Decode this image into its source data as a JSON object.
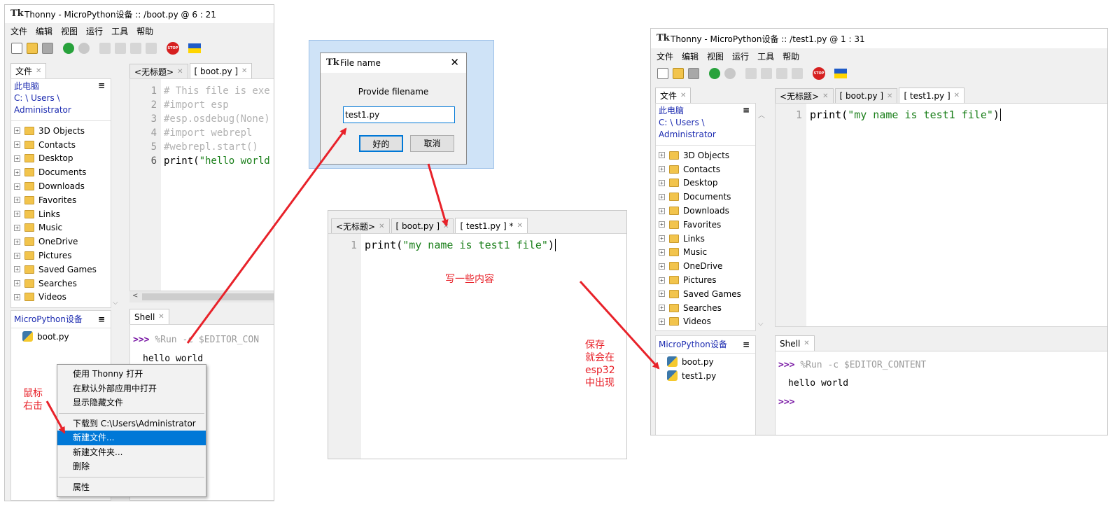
{
  "left_window": {
    "title": "Thonny  -  MicroPython设备 :: /boot.py  @  6 : 21",
    "menu": [
      "文件",
      "编辑",
      "视图",
      "运行",
      "工具",
      "帮助"
    ],
    "files_tab": "文件",
    "editor_tabs": [
      "<无标题>",
      "[ boot.py ]"
    ],
    "file_header": [
      "此电脑",
      "C: \\ Users \\",
      "Administrator"
    ],
    "folders": [
      "3D Objects",
      "Contacts",
      "Desktop",
      "Documents",
      "Downloads",
      "Favorites",
      "Links",
      "Music",
      "OneDrive",
      "Pictures",
      "Saved Games",
      "Searches",
      "Videos"
    ],
    "device_header": "MicroPython设备",
    "device_files": [
      "boot.py"
    ],
    "line_numbers": [
      "1",
      "2",
      "3",
      "4",
      "5",
      "6"
    ],
    "code": [
      "# This file is exe",
      "#import esp",
      "#esp.osdebug(None)",
      "#import webrepl",
      "#webrepl.start()",
      "print(\"hello world"
    ],
    "shell_tab": "Shell",
    "shell_prompt": ">>>",
    "shell_cmd": "%Run -c $EDITOR_CON",
    "shell_output": "hello world"
  },
  "context_menu": {
    "group1": [
      "使用 Thonny 打开",
      "在默认外部应用中打开",
      "显示隐藏文件"
    ],
    "group2": [
      "下载到 C:\\Users\\Administrator",
      "新建文件...",
      "新建文件夹...",
      "删除"
    ],
    "group3": [
      "属性"
    ],
    "highlighted": "新建文件..."
  },
  "dialog": {
    "title": "File name",
    "close": "✕",
    "prompt": "Provide filename",
    "value": "test1.py",
    "ok": "好的",
    "cancel": "取消"
  },
  "mid_editor": {
    "tabs": [
      "<无标题>",
      "[ boot.py ]",
      "[ test1.py ] *"
    ],
    "line_number": "1",
    "code": "print(\"my name is test1 file\")"
  },
  "right_window": {
    "title": "Thonny  -  MicroPython设备 :: /test1.py  @  1 : 31",
    "menu": [
      "文件",
      "编辑",
      "视图",
      "运行",
      "工具",
      "帮助"
    ],
    "files_tab": "文件",
    "editor_tabs": [
      "<无标题>",
      "[ boot.py ]",
      "[ test1.py ]"
    ],
    "file_header": [
      "此电脑",
      "C: \\ Users \\",
      "Administrator"
    ],
    "folders": [
      "3D Objects",
      "Contacts",
      "Desktop",
      "Documents",
      "Downloads",
      "Favorites",
      "Links",
      "Music",
      "OneDrive",
      "Pictures",
      "Saved Games",
      "Searches",
      "Videos"
    ],
    "device_header": "MicroPython设备",
    "device_files": [
      "boot.py",
      "test1.py"
    ],
    "line_number": "1",
    "code": "print(\"my name is test1 file\")",
    "shell_tab": "Shell",
    "shell_prompt": ">>>",
    "shell_cmd": "%Run -c $EDITOR_CONTENT",
    "shell_output": "hello world"
  },
  "annotations": {
    "right_click": [
      "鼠标",
      "右击"
    ],
    "write": "写一些内容",
    "save": [
      "保存",
      "就会在",
      "esp32",
      "中出现"
    ]
  },
  "colors": {
    "annotation": "#e8222a",
    "highlight": "#0078d7",
    "prompt": "#7a1aa5",
    "string": "#1a7f1a"
  }
}
